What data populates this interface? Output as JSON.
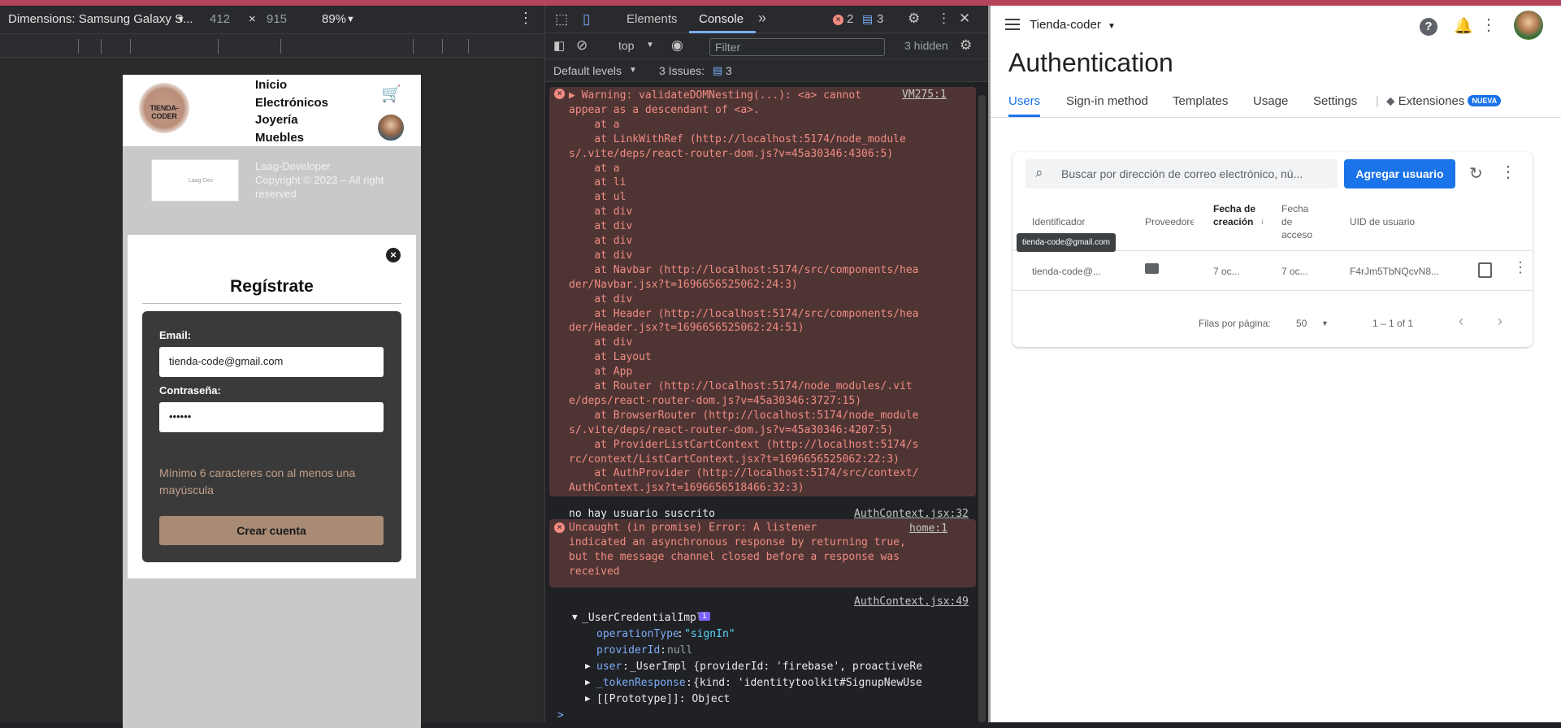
{
  "device_toolbar": {
    "device": "Dimensions: Samsung Galaxy S...",
    "width": "412",
    "times": "×",
    "height": "915",
    "zoom": "89%"
  },
  "site": {
    "logo_text": "TIENDA-CODER",
    "nav": [
      "Inicio",
      "Electrónicos",
      "Joyería",
      "Muebles"
    ],
    "footer_logo_text": "Laag-Dev",
    "footer_lines": [
      "Laag-Developer",
      "Copyright © 2023 – All right reserved"
    ],
    "modal": {
      "close_glyph": "×",
      "title": "Regístrate",
      "email_label": "Email:",
      "email_value": "tienda-code@gmail.com",
      "password_label": "Contraseña:",
      "password_value": "••••••",
      "hint": "Mínimo 6 caracteres con al menos una mayúscula",
      "submit": "Crear cuenta"
    }
  },
  "devtools": {
    "tabs": [
      "Elements",
      "Console"
    ],
    "active_tab": "Console",
    "more_tabs_glyph": "»",
    "error_count": "2",
    "issue_count": "3",
    "context": "top",
    "filter_placeholder": "Filter",
    "hidden": "3 hidden",
    "levels": "Default levels",
    "issues_label": "3 Issues:",
    "issues_badge": "3",
    "prompt": ">",
    "console": {
      "warning_lines": [
        "▶ Warning: validateDOMNesting(...): <a> cannot",
        "appear as a descendant of <a>.",
        "    at a",
        "    at LinkWithRef (http://localhost:5174/node_module",
        "s/.vite/deps/react-router-dom.js?v=45a30346:4306:5)",
        "    at a",
        "    at li",
        "    at ul",
        "    at div",
        "    at div",
        "    at div",
        "    at div",
        "    at Navbar (http://localhost:5174/src/components/hea",
        "der/Navbar.jsx?t=1696656525062:24:3)",
        "    at div",
        "    at Header (http://localhost:5174/src/components/hea",
        "der/Header.jsx?t=1696656525062:24:51)",
        "    at div",
        "    at Layout",
        "    at App",
        "    at Router (http://localhost:5174/node_modules/.vit",
        "e/deps/react-router-dom.js?v=45a30346:3727:15)",
        "    at BrowserRouter (http://localhost:5174/node_module",
        "s/.vite/deps/react-router-dom.js?v=45a30346:4207:5)",
        "    at ProviderListCartContext (http://localhost:5174/s",
        "rc/context/ListCartContext.jsx?t=1696656525062:22:3)",
        "    at AuthProvider (http://localhost:5174/src/context/",
        "AuthContext.jsx?t=1696656518466:32:3)"
      ],
      "warning_source": "VM275:1",
      "log1_text": "no hay usuario suscrito",
      "log1_source": "AuthContext.jsx:32",
      "error_lines": [
        "Uncaught (in promise) Error: A listener",
        "indicated an asynchronous response by returning true,",
        "but the message channel closed before a response was",
        "received"
      ],
      "error_source": "home:1",
      "log2_source": "AuthContext.jsx:49",
      "object_name": "_UserCredentialImpl",
      "object_badge": "i",
      "op_key": "operationType",
      "op_val": "\"signIn\"",
      "provider_key": "providerId",
      "provider_val": "null",
      "user_key": "user",
      "user_val": "_UserImpl {providerId: 'firebase', proactiveRe",
      "token_key": "_tokenResponse",
      "token_val": "{kind: 'identitytoolkit#SignupNewUse",
      "proto": "[[Prototype]]: Object"
    }
  },
  "firebase": {
    "project": "Tienda-coder",
    "help_glyph": "?",
    "title": "Authentication",
    "tabs": [
      "Users",
      "Sign-in method",
      "Templates",
      "Usage",
      "Settings",
      "Extensiones"
    ],
    "new_badge": "NUEVA",
    "search_placeholder": "Buscar por dirección de correo electrónico, nú...",
    "add_user": "Agregar usuario",
    "columns": [
      "Identificador",
      "Proveedore",
      "Fecha de creación",
      "Fecha de acceso",
      "UID de usuario"
    ],
    "tooltip": "tienda-code@gmail.com",
    "row": {
      "identifier": "tienda-code@...",
      "created": "7 oc...",
      "accessed": "7 oc...",
      "uid": "F4rJm5TbNQcvN8..."
    },
    "rows_per_page_label": "Filas por página:",
    "rows_per_page": "50",
    "range": "1 – 1 of 1"
  },
  "colors": {
    "accent_blue": "#1a73e8",
    "console_error": "#f28b82",
    "console_error_bg": "#4e3534",
    "form_button": "#a88a75",
    "hint_text": "#c19f89"
  }
}
